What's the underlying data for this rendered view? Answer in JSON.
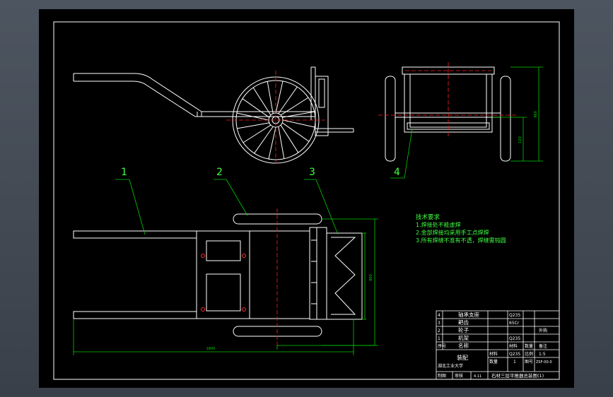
{
  "colors": {
    "canvas": "#000000",
    "line": "#ffffff",
    "dim": "#00d000",
    "center": "#ff2020",
    "hole": "#ff3030",
    "text_green": "#40ff40",
    "title_text": "#ffffff"
  },
  "callouts": [
    "1",
    "2",
    "3",
    "4"
  ],
  "tech_notes": {
    "title": "技术要求",
    "lines": [
      "1.焊接处不能虚焊",
      "2.金部焊接均采用手工点焊焊",
      "3.所有焊缝不准有不透，焊缝需钝圆"
    ]
  },
  "dimensions": {
    "overall_length": "1800",
    "frame_height": "800",
    "side_height": "960",
    "wheel_offset": "120"
  },
  "title_block": {
    "bom_rows": [
      {
        "no": "4",
        "name": "轴承支座",
        "qty": "",
        "material": "Q235",
        "note": ""
      },
      {
        "no": "3",
        "name": "耙齿",
        "qty": "",
        "material": "65Cr",
        "note": ""
      },
      {
        "no": "2",
        "name": "轮子",
        "qty": "",
        "material": "",
        "note": "外购"
      },
      {
        "no": "1",
        "name": "机架",
        "qty": "",
        "material": "Q235",
        "note": ""
      }
    ],
    "header": {
      "no": "序号",
      "name": "名称",
      "qty": "数量",
      "material": "材料",
      "note": "备注"
    },
    "material_label": "材料",
    "material_value": "Q235",
    "scale_label": "比例",
    "scale_value": "1:5",
    "qty_label": "数量",
    "qty_value": "1",
    "drawing_no_label": "图号",
    "drawing_no_value": "ZSF-00-0",
    "assembly_label": "装配",
    "designer_label": "制图",
    "checker_label": "审核",
    "date_value": "4.11",
    "footer_left": "湖北工业大学",
    "footer_title": "石材三层平推器总装图(1)"
  }
}
